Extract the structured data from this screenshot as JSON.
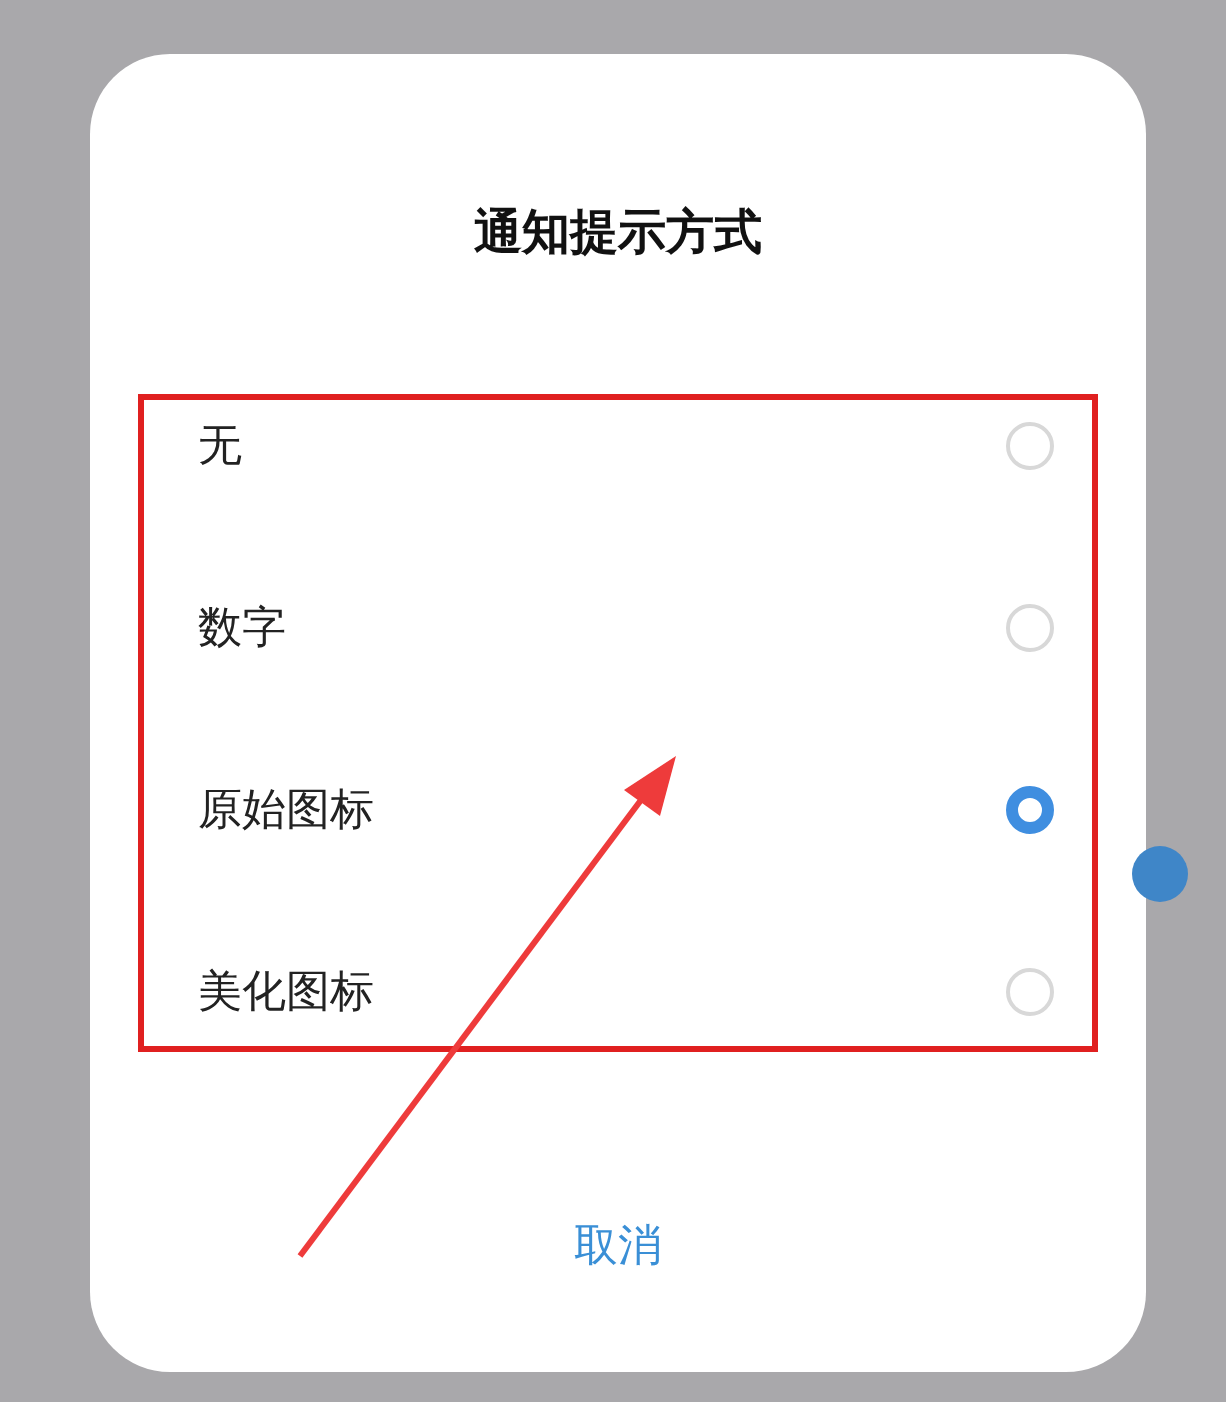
{
  "dialog": {
    "title": "通知提示方式",
    "options": [
      {
        "label": "无",
        "selected": false
      },
      {
        "label": "数字",
        "selected": false
      },
      {
        "label": "原始图标",
        "selected": true
      },
      {
        "label": "美化图标",
        "selected": false
      }
    ],
    "cancel_button": "取消"
  }
}
